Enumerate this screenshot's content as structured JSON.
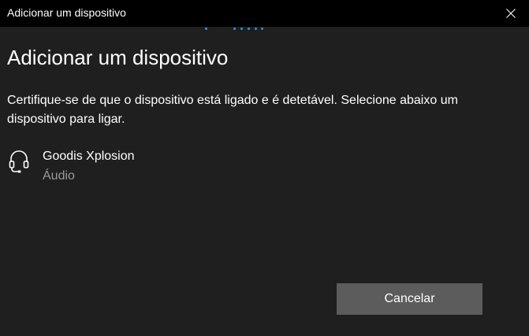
{
  "window": {
    "title": "Adicionar um dispositivo"
  },
  "titlebar": {
    "close_icon": "close-icon"
  },
  "main": {
    "title": "Adicionar um dispositivo",
    "description": "Certifique-se de que o dispositivo está ligado e é detetável. Selecione abaixo um dispositivo para ligar.",
    "progress_indicator": "searching-dots"
  },
  "devices": [
    {
      "name": "Goodis Xplosion",
      "type": "Áudio",
      "icon": "headset-icon"
    }
  ],
  "footer": {
    "cancel_label": "Cancelar"
  },
  "colors": {
    "titlebar_bg": "#000000",
    "window_bg": "#1f1f1f",
    "accent": "#3a8fd9",
    "button_bg": "#5c5c5c",
    "secondary_text": "#9a9a9a"
  }
}
